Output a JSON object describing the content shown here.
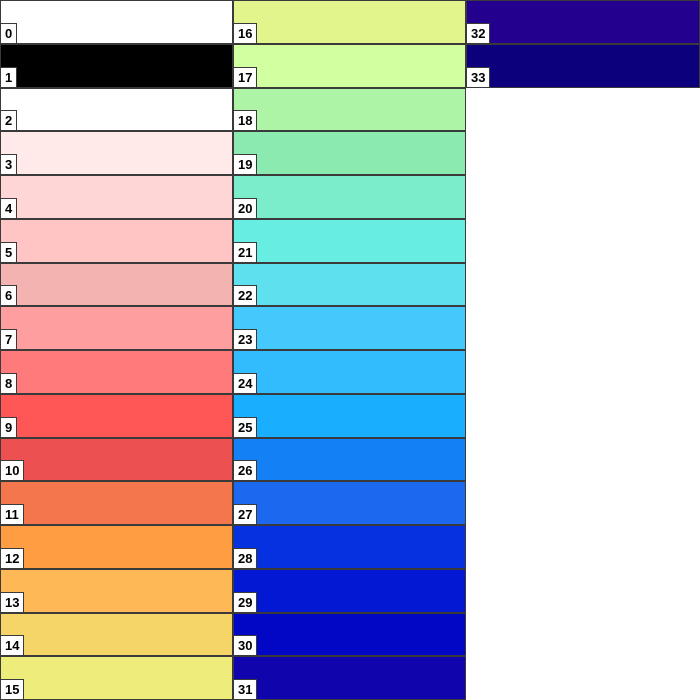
{
  "swatches": [
    {
      "label": "0",
      "color": "#ffffff"
    },
    {
      "label": "1",
      "color": "#000000"
    },
    {
      "label": "2",
      "color": "#ffffff"
    },
    {
      "label": "3",
      "color": "#ffe9e9"
    },
    {
      "label": "4",
      "color": "#ffd6d6"
    },
    {
      "label": "5",
      "color": "#ffc4c4"
    },
    {
      "label": "6",
      "color": "#f3b3b0"
    },
    {
      "label": "7",
      "color": "#ff9e9e"
    },
    {
      "label": "8",
      "color": "#ff7b7b"
    },
    {
      "label": "9",
      "color": "#ff5656"
    },
    {
      "label": "10",
      "color": "#ec5050"
    },
    {
      "label": "11",
      "color": "#f4764c"
    },
    {
      "label": "12",
      "color": "#ff9d43"
    },
    {
      "label": "13",
      "color": "#ffb856"
    },
    {
      "label": "14",
      "color": "#f5d468"
    },
    {
      "label": "15",
      "color": "#eeec7a"
    },
    {
      "label": "16",
      "color": "#e2f48c"
    },
    {
      "label": "17",
      "color": "#d2ffa0"
    },
    {
      "label": "18",
      "color": "#aef4a6"
    },
    {
      "label": "19",
      "color": "#8aeab0"
    },
    {
      "label": "20",
      "color": "#7bedcb"
    },
    {
      "label": "21",
      "color": "#68ede2"
    },
    {
      "label": "22",
      "color": "#5fe0ef"
    },
    {
      "label": "23",
      "color": "#45c9fc"
    },
    {
      "label": "24",
      "color": "#32bcfe"
    },
    {
      "label": "25",
      "color": "#1aaeff"
    },
    {
      "label": "26",
      "color": "#1380f6"
    },
    {
      "label": "27",
      "color": "#1c68ee"
    },
    {
      "label": "28",
      "color": "#0631e0"
    },
    {
      "label": "29",
      "color": "#0218d2"
    },
    {
      "label": "30",
      "color": "#0207c6"
    },
    {
      "label": "31",
      "color": "#1005ac"
    },
    {
      "label": "32",
      "color": "#24008e"
    },
    {
      "label": "33",
      "color": "#0c007c"
    }
  ]
}
